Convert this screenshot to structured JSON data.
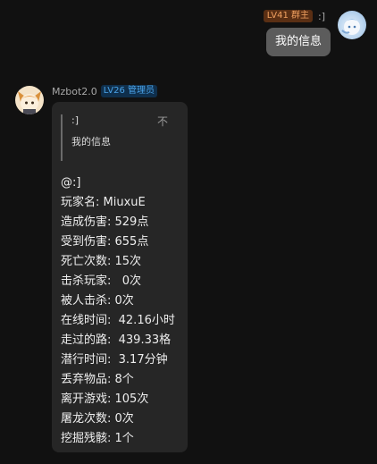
{
  "self_message": {
    "level_badge": "LV41 群主",
    "sender_name": ":]",
    "text": "我的信息"
  },
  "bot_message": {
    "sender_name": "Mzbot2.0",
    "level_badge": "LV26 管理员",
    "quote": {
      "author": ":]",
      "text": "我的信息",
      "close_glyph": "不"
    },
    "lines": [
      "@:]",
      "玩家名: MiuxuE",
      "造成伤害: 529点",
      "受到伤害: 655点",
      "死亡次数: 15次",
      "击杀玩家:   0次",
      "被人击杀: 0次",
      "在线时间:  42.16小时",
      "走过的路:  439.33格",
      "潜行时间:  3.17分钟",
      "丢弃物品: 8个",
      "离开游戏: 105次",
      "屠龙次数: 0次",
      "挖掘残骸: 1个"
    ]
  },
  "colors": {
    "background": "#111111",
    "self_bubble": "#5c5c5c",
    "bot_bubble": "#262626",
    "owner_badge": "#5a2f14",
    "admin_badge": "#0f2f4c"
  }
}
